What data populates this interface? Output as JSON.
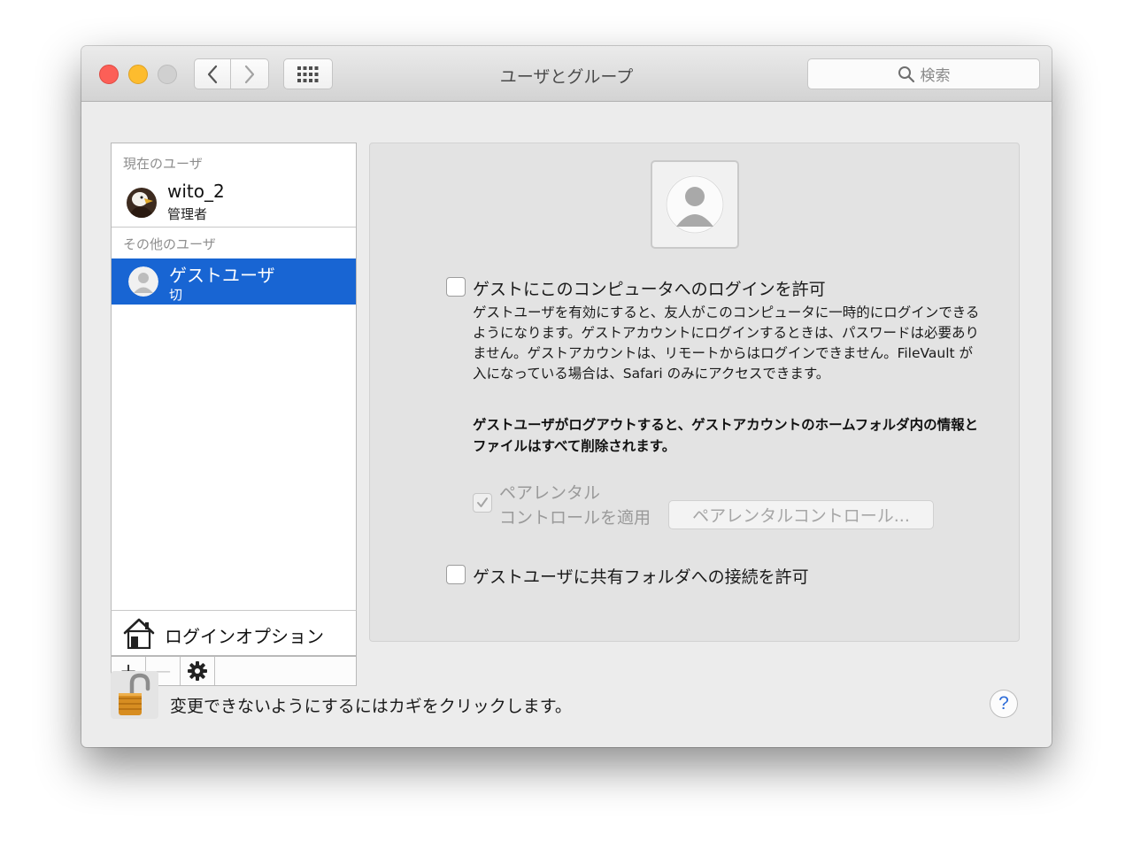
{
  "window": {
    "title": "ユーザとグループ",
    "search_placeholder": "検索"
  },
  "sidebar": {
    "current_user_header": "現在のユーザ",
    "current_user": {
      "name": "wito_2",
      "role": "管理者"
    },
    "other_users_header": "その他のユーザ",
    "other_users": [
      {
        "name": "ゲストユーザ",
        "status": "切",
        "selected": true
      }
    ],
    "login_options_label": "ログインオプション",
    "add_label": "+",
    "remove_label": "—"
  },
  "guest_panel": {
    "allow_login_label": "ゲストにこのコンピュータへのログインを許可",
    "allow_login_checked": false,
    "description": "ゲストユーザを有効にすると、友人がこのコンピュータに一時的にログインできるようになります。ゲストアカウントにログインするときは、パスワードは必要ありません。ゲストアカウントは、リモートからはログインできません。FileVault が入になっている場合は、Safari のみにアクセスできます。",
    "warning": "ゲストユーザがログアウトすると、ゲストアカウントのホームフォルダ内の情報とファイルはすべて削除されます。",
    "parental_line1": "ペアレンタル",
    "parental_line2": "コントロールを適用",
    "parental_checked": true,
    "parental_button": "ペアレンタルコントロール...",
    "shared_folders_label": "ゲストユーザに共有フォルダへの接続を許可",
    "shared_folders_checked": false
  },
  "footer": {
    "lock_text": "変更できないようにするにはカギをクリックします。",
    "help_label": "?"
  },
  "colors": {
    "selection": "#1865d3",
    "close": "#fc5f57",
    "minimize": "#fdbc2e",
    "help_accent": "#2d6cd8"
  }
}
